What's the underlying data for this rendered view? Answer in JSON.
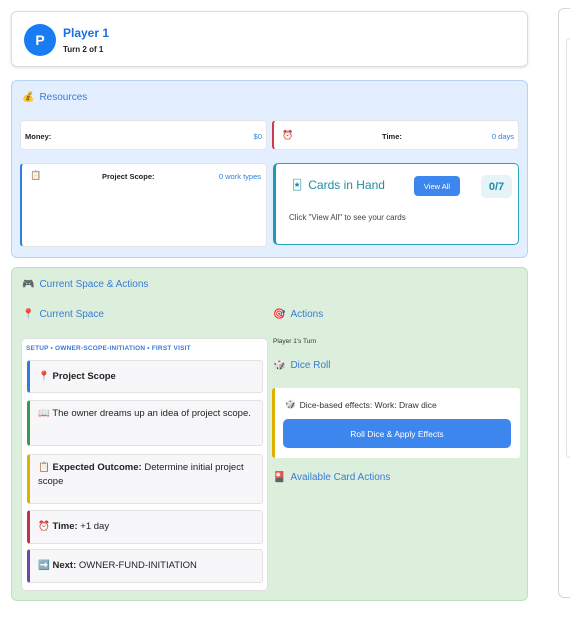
{
  "player": {
    "avatar_letter": "P",
    "name": "Player 1",
    "turn": "Turn 2 of 1"
  },
  "resources": {
    "icon": "💰",
    "title": "Resources",
    "money": {
      "label": "Money:",
      "value": "$0"
    },
    "time": {
      "icon": "⏰",
      "label": "Time:",
      "value": "0 days"
    },
    "project_scope": {
      "icon": "📋",
      "label": "Project Scope:",
      "value": "0 work types"
    }
  },
  "cards": {
    "icon": "🃏",
    "title": "Cards in Hand",
    "view_all": "View All",
    "count": "0/7",
    "hint": "Click \"View All\" to see your cards"
  },
  "current_section": {
    "icon": "🎮",
    "title": "Current Space & Actions"
  },
  "current_space": {
    "icon": "📍",
    "title": "Current Space",
    "subtitle": "SETUP • OWNER-SCOPE-INITIATION • FIRST VISIT",
    "space_name_icon": "📍",
    "space_name": "Project Scope",
    "description_icon": "📖",
    "description": "The owner dreams up an idea of project scope.",
    "outcome_icon": "📋",
    "outcome_label": "Expected Outcome:",
    "outcome_text": "Determine initial project scope",
    "time_icon": "⏰",
    "time_label": "Time:",
    "time_text": "+1 day",
    "next_icon": "➡️",
    "next_label": "Next:",
    "next_text": "OWNER-FUND-INITIATION"
  },
  "actions": {
    "icon": "🎯",
    "title": "Actions",
    "turn_label": "Player 1's Turn",
    "dice_icon": "🎲",
    "dice_title": "Dice Roll",
    "dice_effects_icon": "🎲",
    "dice_effects": "Dice-based effects: Work: Draw dice",
    "roll_button": "Roll Dice & Apply Effects",
    "card_actions_icon": "🎴",
    "card_actions_title": "Available Card Actions"
  },
  "colors": {
    "accent_blue": "#3d86ee",
    "title_blue": "#1a6fe0",
    "teal": "#1e9bb0",
    "resources_bg": "#e3efff",
    "actions_bg": "#dcefdc"
  }
}
